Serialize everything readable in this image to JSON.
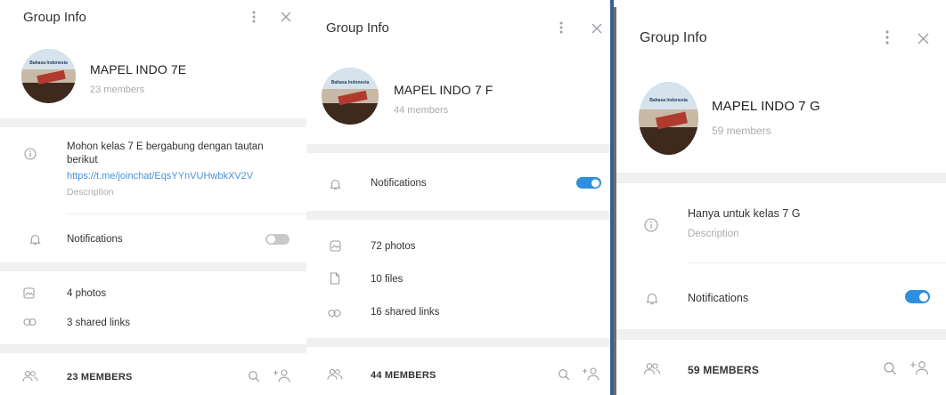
{
  "panels": [
    {
      "header_title": "Group Info",
      "group_name": "MAPEL INDO 7E",
      "members_count": "23 members",
      "avatar_text": "Bahasa Indonesia",
      "description_text": "Mohon kelas 7 E bergabung dengan tautan berikut",
      "description_link": "https://t.me/joinchat/EqsYYnVUHwbkXV2V",
      "description_label": "Description",
      "notifications_label": "Notifications",
      "notifications_on": false,
      "media": [
        "4 photos",
        "3 shared links"
      ],
      "members_label": "23 MEMBERS"
    },
    {
      "header_title": "Group Info",
      "group_name": "MAPEL INDO 7 F",
      "members_count": "44 members",
      "avatar_text": "Bahasa Indonesia",
      "notifications_label": "Notifications",
      "notifications_on": true,
      "media": [
        "72 photos",
        "10 files",
        "16 shared links"
      ],
      "members_label": "44 MEMBERS"
    },
    {
      "header_title": "Group Info",
      "group_name": "MAPEL INDO 7 G",
      "members_count": "59 members",
      "avatar_text": "Bahasa Indonesia",
      "description_text": "Hanya untuk kelas 7 G",
      "description_label": "Description",
      "notifications_label": "Notifications",
      "notifications_on": true,
      "members_label": "59 MEMBERS"
    }
  ],
  "colors": {
    "toggle_on": "#2e8fe0",
    "toggle_off": "#c9c9c9",
    "link": "#4a90d9",
    "icon": "#9aa0a6"
  }
}
